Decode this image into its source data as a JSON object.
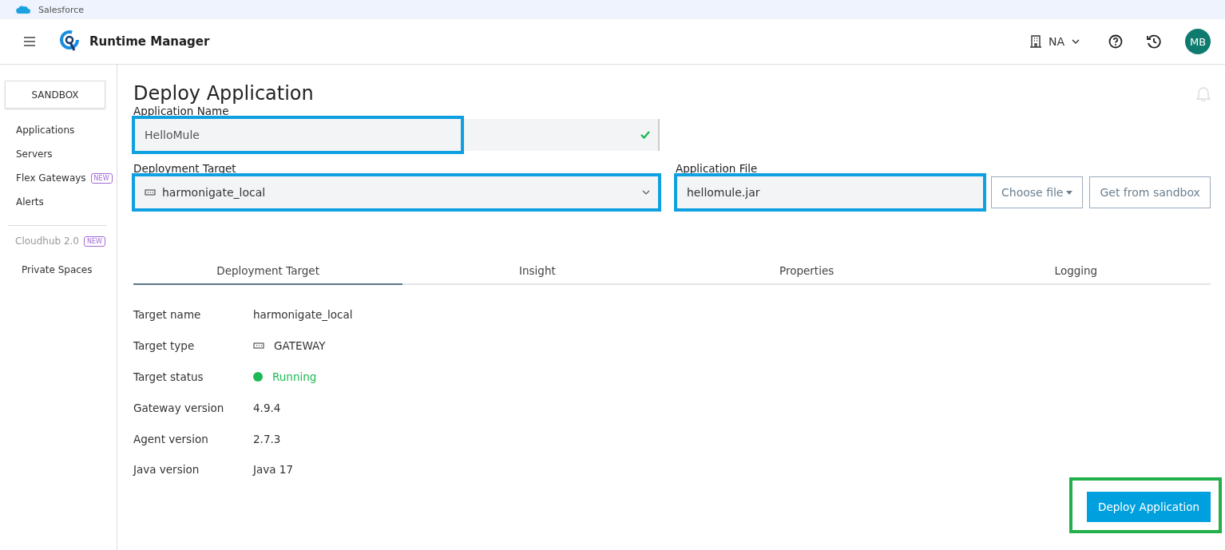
{
  "browser_bar": {
    "title": "Salesforce"
  },
  "header": {
    "app_name": "Runtime Manager",
    "region": "NA",
    "avatar": "MB"
  },
  "sidebar": {
    "environment": "SANDBOX",
    "items": [
      {
        "label": "Applications",
        "kind": "link"
      },
      {
        "label": "Servers",
        "kind": "link"
      },
      {
        "label": "Flex Gateways",
        "badge": "NEW",
        "kind": "link"
      },
      {
        "label": "Alerts",
        "kind": "link"
      },
      {
        "label": "Cloudhub 2.0",
        "badge": "NEW",
        "kind": "section"
      },
      {
        "label": "Private Spaces",
        "kind": "sublink"
      }
    ]
  },
  "page_title": "Deploy Application",
  "app_name_field": {
    "label": "Application Name",
    "value": "HelloMule",
    "valid": true,
    "color": "#0ea0e0"
  },
  "target_field": {
    "label": "Deployment Target",
    "value": "harmonigate_local",
    "color": "#0ea0e0"
  },
  "file_field": {
    "label": "Application File",
    "value": "hellomule.jar",
    "color": "#0ea0e0"
  },
  "file_buttons": [
    {
      "label": "Choose file",
      "dropdown": true
    },
    {
      "label": "Get from sandbox",
      "dropdown": false
    }
  ],
  "tabs": [
    {
      "label": "Deployment Target",
      "selected": true
    },
    {
      "label": "Insight",
      "selected": false
    },
    {
      "label": "Properties",
      "selected": false
    },
    {
      "label": "Logging",
      "selected": false
    }
  ],
  "details": [
    {
      "label": "Target name",
      "value": "harmonigate_local",
      "kind": "text"
    },
    {
      "label": "Target type",
      "value": "GATEWAY",
      "kind": "gateway"
    },
    {
      "label": "Target status",
      "value": "Running",
      "kind": "status",
      "color": "#1db954"
    },
    {
      "label": "Gateway version",
      "value": "4.9.4",
      "kind": "text"
    },
    {
      "label": "Agent version",
      "value": "2.7.3",
      "kind": "text"
    },
    {
      "label": "Java version",
      "value": "Java 17",
      "kind": "text"
    }
  ],
  "deploy_button": {
    "label": "Deploy Application",
    "color": "#22b04b"
  }
}
